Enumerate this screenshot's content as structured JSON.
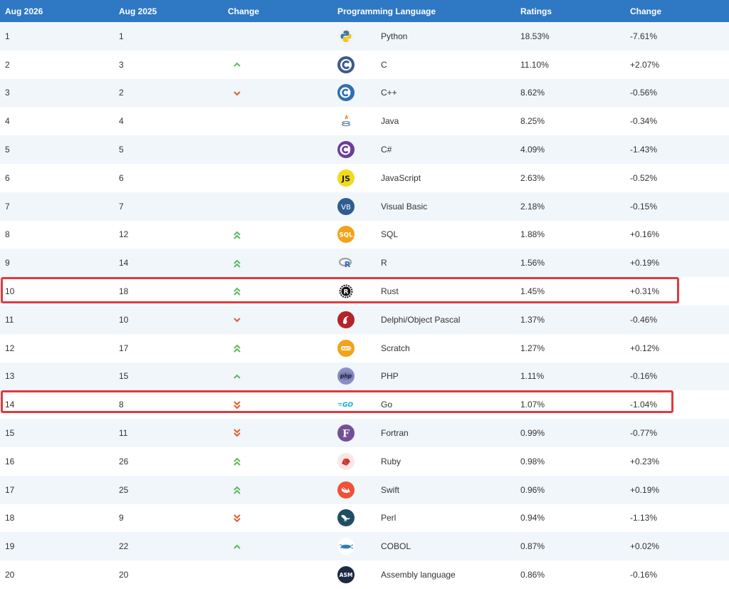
{
  "headers": {
    "current": "Aug 2026",
    "previous": "Aug 2025",
    "change": "Change",
    "language": "Programming Language",
    "ratings": "Ratings",
    "ratings_change": "Change"
  },
  "colors": {
    "header_bg": "#2f78c3",
    "up": "#5cb85c",
    "down": "#e35b2b",
    "highlight": "#e0393e"
  },
  "rows": [
    {
      "rank": "1",
      "prev": "1",
      "trend": "none",
      "language": "Python",
      "icon": "python-icon",
      "rating": "18.53%",
      "change": "-7.61%"
    },
    {
      "rank": "2",
      "prev": "3",
      "trend": "up",
      "language": "C",
      "icon": "c-icon",
      "rating": "11.10%",
      "change": "+2.07%"
    },
    {
      "rank": "3",
      "prev": "2",
      "trend": "down",
      "language": "C++",
      "icon": "cpp-icon",
      "rating": "8.62%",
      "change": "-0.56%"
    },
    {
      "rank": "4",
      "prev": "4",
      "trend": "none",
      "language": "Java",
      "icon": "java-icon",
      "rating": "8.25%",
      "change": "-0.34%"
    },
    {
      "rank": "5",
      "prev": "5",
      "trend": "none",
      "language": "C#",
      "icon": "csharp-icon",
      "rating": "4.09%",
      "change": "-1.43%"
    },
    {
      "rank": "6",
      "prev": "6",
      "trend": "none",
      "language": "JavaScript",
      "icon": "javascript-icon",
      "rating": "2.63%",
      "change": "-0.52%"
    },
    {
      "rank": "7",
      "prev": "7",
      "trend": "none",
      "language": "Visual Basic",
      "icon": "visual-basic-icon",
      "rating": "2.18%",
      "change": "-0.15%"
    },
    {
      "rank": "8",
      "prev": "12",
      "trend": "up2",
      "language": "SQL",
      "icon": "sql-icon",
      "rating": "1.88%",
      "change": "+0.16%"
    },
    {
      "rank": "9",
      "prev": "14",
      "trend": "up2",
      "language": "R",
      "icon": "r-icon",
      "rating": "1.56%",
      "change": "+0.19%"
    },
    {
      "rank": "10",
      "prev": "18",
      "trend": "up2",
      "language": "Rust",
      "icon": "rust-icon",
      "rating": "1.45%",
      "change": "+0.31%",
      "highlighted": true
    },
    {
      "rank": "11",
      "prev": "10",
      "trend": "down",
      "language": "Delphi/Object Pascal",
      "icon": "delphi-icon",
      "rating": "1.37%",
      "change": "-0.46%"
    },
    {
      "rank": "12",
      "prev": "17",
      "trend": "up2",
      "language": "Scratch",
      "icon": "scratch-icon",
      "rating": "1.27%",
      "change": "+0.12%"
    },
    {
      "rank": "13",
      "prev": "15",
      "trend": "up",
      "language": "PHP",
      "icon": "php-icon",
      "rating": "1.11%",
      "change": "-0.16%"
    },
    {
      "rank": "14",
      "prev": "8",
      "trend": "down2",
      "language": "Go",
      "icon": "go-icon",
      "rating": "1.07%",
      "change": "-1.04%",
      "highlighted": true
    },
    {
      "rank": "15",
      "prev": "11",
      "trend": "down2",
      "language": "Fortran",
      "icon": "fortran-icon",
      "rating": "0.99%",
      "change": "-0.77%"
    },
    {
      "rank": "16",
      "prev": "26",
      "trend": "up2",
      "language": "Ruby",
      "icon": "ruby-icon",
      "rating": "0.98%",
      "change": "+0.23%"
    },
    {
      "rank": "17",
      "prev": "25",
      "trend": "up2",
      "language": "Swift",
      "icon": "swift-icon",
      "rating": "0.96%",
      "change": "+0.19%"
    },
    {
      "rank": "18",
      "prev": "9",
      "trend": "down2",
      "language": "Perl",
      "icon": "perl-icon",
      "rating": "0.94%",
      "change": "-1.13%"
    },
    {
      "rank": "19",
      "prev": "22",
      "trend": "up",
      "language": "COBOL",
      "icon": "cobol-icon",
      "rating": "0.87%",
      "change": "+0.02%"
    },
    {
      "rank": "20",
      "prev": "20",
      "trend": "none",
      "language": "Assembly language",
      "icon": "assembly-icon",
      "rating": "0.86%",
      "change": "-0.16%"
    }
  ]
}
